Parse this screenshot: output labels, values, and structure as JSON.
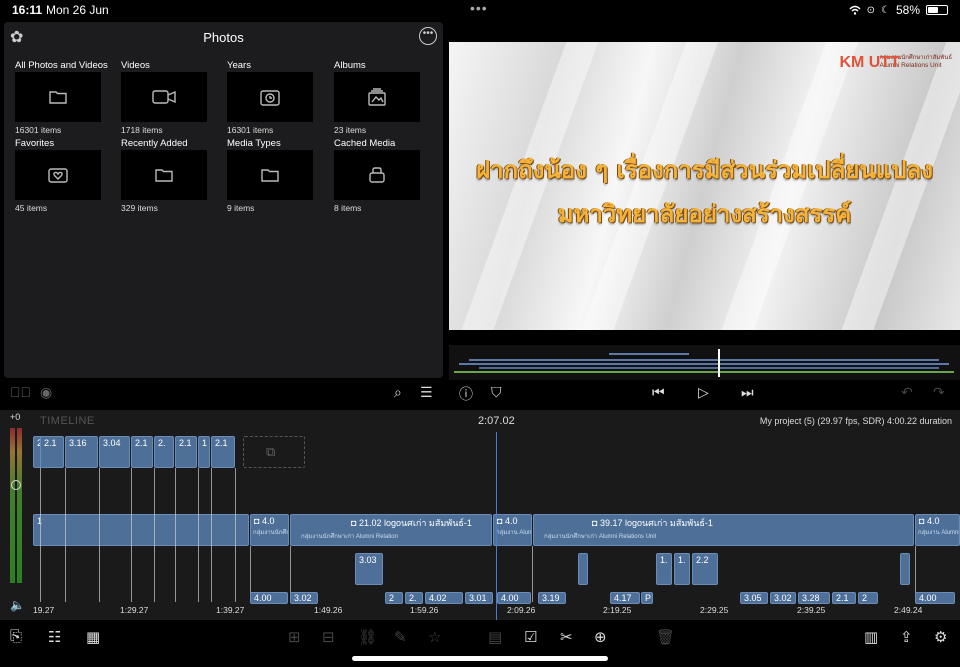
{
  "status": {
    "time": "16:11",
    "date": "Mon 26 Jun",
    "battery": "58%",
    "battery_level": 0.58
  },
  "photos": {
    "title": "Photos",
    "tiles": [
      {
        "label": "All Photos and Videos",
        "count": "16301 items",
        "icon": "folder-icon"
      },
      {
        "label": "Videos",
        "count": "1718 items",
        "icon": "video-camera-icon"
      },
      {
        "label": "Years",
        "count": "16301 items",
        "icon": "calendar-clock-icon"
      },
      {
        "label": "Albums",
        "count": "23 items",
        "icon": "album-stack-icon"
      },
      {
        "label": "Favorites",
        "count": "45 items",
        "icon": "heart-folder-icon"
      },
      {
        "label": "Recently Added",
        "count": "329 items",
        "icon": "folder-icon"
      },
      {
        "label": "Media Types",
        "count": "9 items",
        "icon": "folder-icon"
      },
      {
        "label": "Cached Media",
        "count": "8 items",
        "icon": "cache-box-icon"
      }
    ]
  },
  "preview": {
    "headline_line1": "ฝากถึงน้อง ๆ เรื่องการมีส่วนร่วมเปลี่ยนแปลง",
    "headline_line2": "มหาวิทยาลัยอย่างสร้างสรรค์",
    "logo_mark": "KM UTT",
    "logo_line1": "กลุ่มงานนักศึกษาเก่าสัมพันธ์",
    "logo_line2": "Alumni Relations Unit"
  },
  "timeline": {
    "label": "TIMELINE",
    "timecode": "2:07.02",
    "project_info": "My project (5) (29.97 fps, SDR)  4:00.22 duration",
    "meter_label": "+0",
    "top_clips": [
      "2.",
      "2.1",
      "3.16",
      "3.04",
      "2.1",
      "2.",
      "2.1",
      "1",
      "2.1"
    ],
    "main_clips": [
      {
        "label": "1"
      },
      {
        "label": "4.0",
        "sub": "กลุ่มงานนักศึกษาเก่า Alumni Relations"
      },
      {
        "label": "21.02  logoนศเก่า มสัมพันธ์-1",
        "sub": "กลุ่มงานนักศึกษาเก่า Alumni Relation"
      },
      {
        "label": "4.0",
        "sub": "กลุ่มงาน Alumni"
      },
      {
        "label": "39.17  logoนศเก่า มสัมพันธ์-1",
        "sub": "กลุ่มงานนักศึกษาเก่า Alumni Relations Unit"
      },
      {
        "label": "4.0",
        "sub": "กลุ่มงาน Alumni Relati"
      }
    ],
    "lower_clips": [
      "3.03",
      "4.00",
      "3.02",
      "2",
      "2.",
      "4.02",
      "3.01",
      "4.00",
      "3.19",
      "4.17",
      "P",
      "1.",
      "1.",
      "2.2",
      "3.05",
      "3.02",
      "3.28",
      "2.1",
      "2",
      "4.00"
    ],
    "ruler": [
      "19.27",
      "1:29.27",
      "1:39.27",
      "1:49.26",
      "1:59.26",
      "2:09.26",
      "2:19.25",
      "2:29.25",
      "2:39.25",
      "2:49.24"
    ]
  }
}
